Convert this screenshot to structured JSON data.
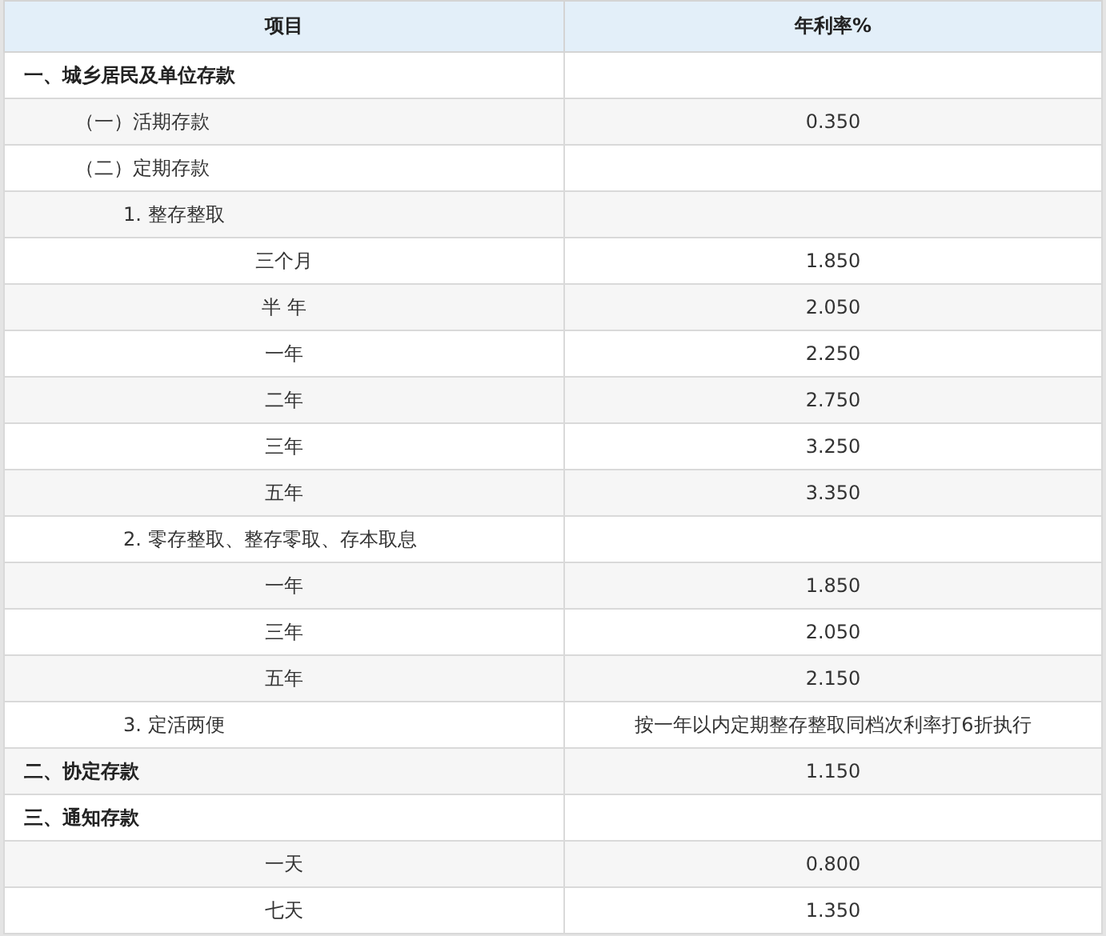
{
  "table": {
    "columns": [
      "项目",
      "年利率%"
    ],
    "rows": [
      {
        "kind": "section",
        "item": "一、城乡居民及单位存款"
      },
      {
        "kind": "sub",
        "item": "（一）活期存款",
        "rate": "0.350"
      },
      {
        "kind": "sub",
        "item": "（二）定期存款"
      },
      {
        "kind": "subsub",
        "item": "1. 整存整取"
      },
      {
        "kind": "term",
        "item": "三个月",
        "rate": "1.850"
      },
      {
        "kind": "term",
        "item": "半 年",
        "rate": "2.050"
      },
      {
        "kind": "term",
        "item": "一年",
        "rate": "2.250"
      },
      {
        "kind": "term",
        "item": "二年",
        "rate": "2.750"
      },
      {
        "kind": "term",
        "item": "三年",
        "rate": "3.250"
      },
      {
        "kind": "term",
        "item": "五年",
        "rate": "3.350"
      },
      {
        "kind": "subsub",
        "item": "2. 零存整取、整存零取、存本取息"
      },
      {
        "kind": "term",
        "item": "一年",
        "rate": "1.850"
      },
      {
        "kind": "term",
        "item": "三年",
        "rate": "2.050"
      },
      {
        "kind": "term",
        "item": "五年",
        "rate": "2.150"
      },
      {
        "kind": "subsub",
        "item": "3. 定活两便",
        "rate": "按一年以内定期整存整取同档次利率打6折执行"
      },
      {
        "kind": "section",
        "item": "二、协定存款",
        "rate": "1.150"
      },
      {
        "kind": "section",
        "item": "三、通知存款"
      },
      {
        "kind": "term",
        "item": "一天",
        "rate": "0.800"
      },
      {
        "kind": "term",
        "item": "七天",
        "rate": "1.350"
      }
    ]
  }
}
